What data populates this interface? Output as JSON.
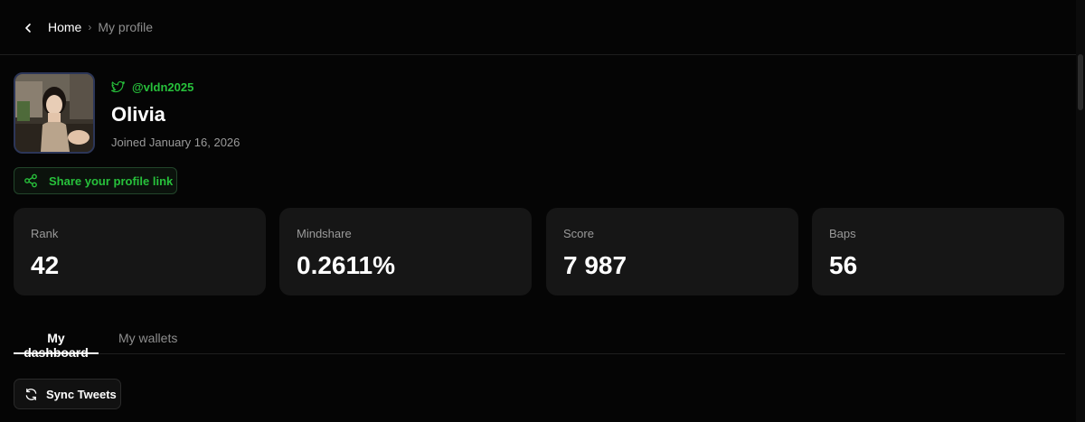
{
  "breadcrumb": {
    "home": "Home",
    "separator": "›",
    "current": "My profile"
  },
  "profile": {
    "handle": "@vldn2025",
    "name": "Olivia",
    "joined": "Joined January 16, 2026",
    "avatar_icon": "profile-photo"
  },
  "share": {
    "label": "Share your profile link",
    "icon": "share-icon"
  },
  "stats": [
    {
      "label": "Rank",
      "value": "42"
    },
    {
      "label": "Mindshare",
      "value": "0.2611%"
    },
    {
      "label": "Score",
      "value": "7 987"
    },
    {
      "label": "Baps",
      "value": "56"
    }
  ],
  "tabs": [
    {
      "label": "My dashboard",
      "active": true
    },
    {
      "label": "My wallets",
      "active": false
    }
  ],
  "sync": {
    "label": "Sync Tweets",
    "icon": "refresh-icon"
  },
  "colors": {
    "background": "#050505",
    "card": "#161616",
    "accent_green": "#27c13b",
    "muted_text": "#9a9a9a"
  }
}
